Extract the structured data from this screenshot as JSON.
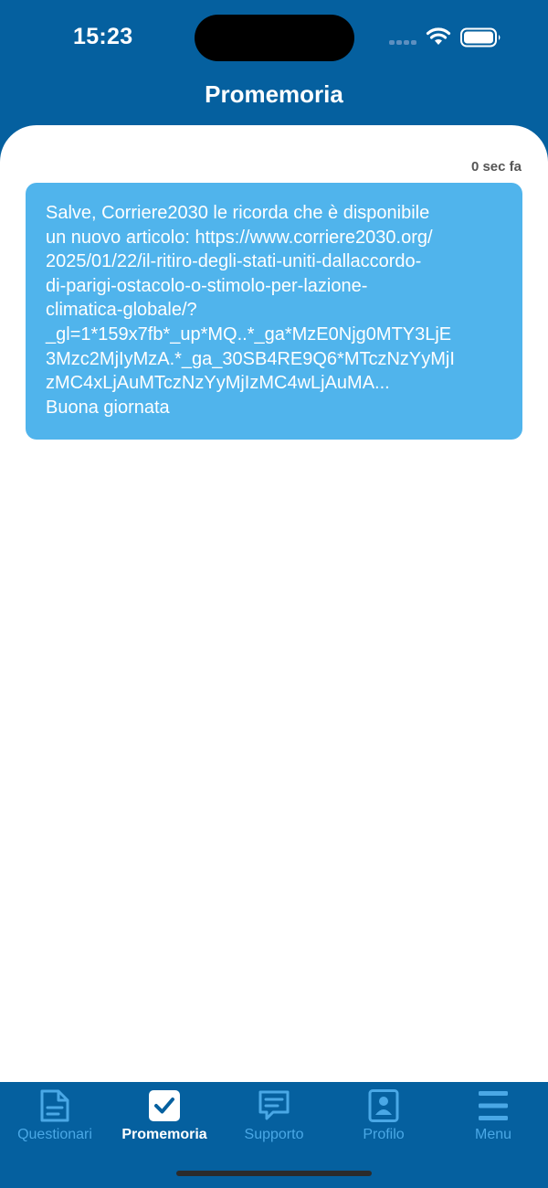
{
  "status_bar": {
    "time": "15:23",
    "icons": [
      "cellular-signal-icon",
      "wifi-icon",
      "battery-icon"
    ]
  },
  "header": {
    "title": "Promemoria"
  },
  "message": {
    "timestamp": "0 sec fa",
    "lines": [
      "Salve, Corriere2030 le ricorda che è disponibile",
      "un nuovo articolo: https://www.corriere2030.org/",
      "2025/01/22/il-ritiro-degli-stati-uniti-dallaccordo-",
      "di-parigi-ostacolo-o-stimolo-per-lazione-",
      "climatica-globale/?",
      "_gl=1*159x7fb*_up*MQ..*_ga*MzE0Njg0MTY3LjE",
      "3Mzc2MjIyMzA.*_ga_30SB4RE9Q6*MTczNzYyMjI",
      "zMC4xLjAuMTczNzYyMjIzMC4wLjAuMA...",
      "Buona giornata"
    ]
  },
  "tab_bar": {
    "items": [
      {
        "label": "Questionari",
        "icon": "document-icon",
        "active": false
      },
      {
        "label": "Promemoria",
        "icon": "checkbox-icon",
        "active": true
      },
      {
        "label": "Supporto",
        "icon": "chat-bubble-icon",
        "active": false
      },
      {
        "label": "Profilo",
        "icon": "profile-icon",
        "active": false
      },
      {
        "label": "Menu",
        "icon": "menu-icon",
        "active": false
      }
    ]
  },
  "colors": {
    "header_background": "#05609f",
    "bubble_background": "#50b4ec",
    "tab_inactive": "#4aa8e6",
    "tab_active": "#ffffff"
  }
}
